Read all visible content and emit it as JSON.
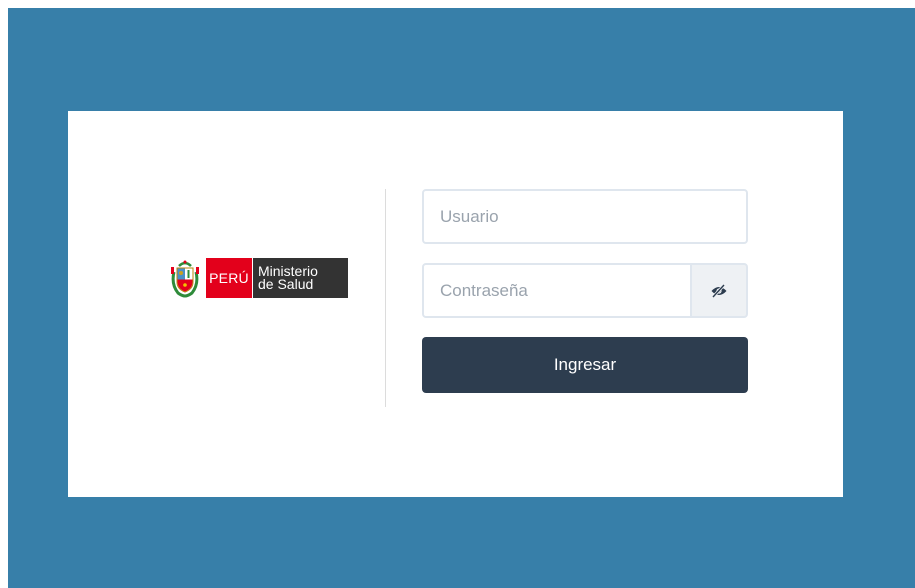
{
  "logo": {
    "country": "PERÚ",
    "ministry_line1": "Ministerio",
    "ministry_line2": "de Salud",
    "emblem_icon": "peru-coat-of-arms-icon"
  },
  "form": {
    "username_placeholder": "Usuario",
    "username_value": "",
    "password_placeholder": "Contraseña",
    "password_value": "",
    "toggle_icon": "eye-slash-icon",
    "submit_label": "Ingresar"
  },
  "colors": {
    "background": "#377fa9",
    "card": "#ffffff",
    "button": "#2d3d4f",
    "brand_red": "#e3001b",
    "brand_dark": "#333333"
  }
}
